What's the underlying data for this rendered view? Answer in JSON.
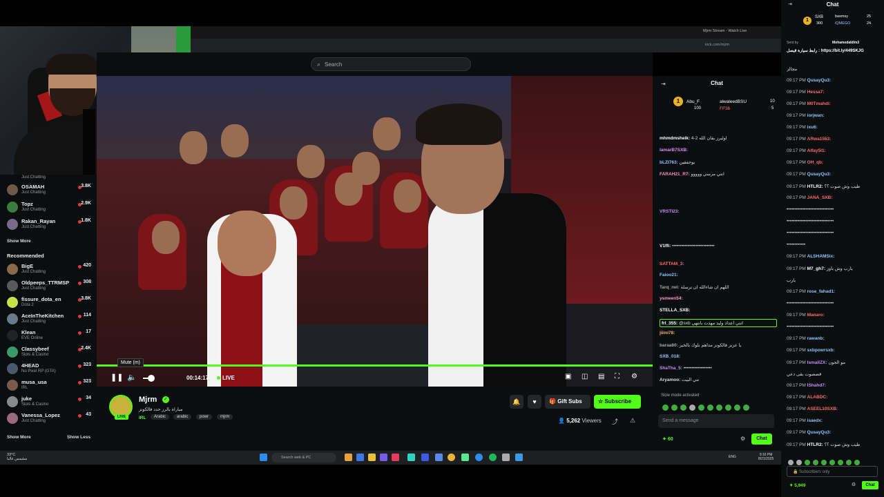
{
  "browser": {
    "tab_title": "Mjrm Stream - Watch Live",
    "url": "kick.com/mjrm"
  },
  "header": {
    "search_placeholder": "Search"
  },
  "sidebar": {
    "following_top": [
      {
        "name": "",
        "category": "Just Chatting",
        "viewers": ""
      },
      {
        "name": "OSAMAH",
        "category": "Just Chatting",
        "viewers": "3.8K"
      },
      {
        "name": "Topz",
        "category": "Just Chatting",
        "viewers": "2.9K"
      },
      {
        "name": "Rakan_Rayan",
        "category": "Just Chatting",
        "viewers": "1.8K"
      }
    ],
    "show_more_1": "Show More",
    "recommended_title": "Recommended",
    "recommended": [
      {
        "name": "BigE",
        "category": "Just Chatting",
        "viewers": "420"
      },
      {
        "name": "Oldpeeps_TTRMSP",
        "category": "Just Chatting",
        "viewers": "308"
      },
      {
        "name": "fissure_dota_en",
        "category": "Dota 2",
        "viewers": "3.8K"
      },
      {
        "name": "AceInTheKitchen",
        "category": "Just Chatting",
        "viewers": "114"
      },
      {
        "name": "Klean",
        "category": "EVE Online",
        "viewers": "17"
      },
      {
        "name": "Classybeef",
        "category": "Slots & Casino",
        "viewers": "2.4K"
      },
      {
        "name": "4HEAD",
        "category": "No Pixel RP (GTA)",
        "viewers": "323"
      },
      {
        "name": "musa_usa",
        "category": "IRL",
        "viewers": "323"
      },
      {
        "name": "juke",
        "category": "Slots & Casino",
        "viewers": "34"
      },
      {
        "name": "Vanessa_Lopez",
        "category": "Just Chatting",
        "viewers": "43"
      }
    ],
    "show_more_2": "Show More",
    "show_less": "Show Less"
  },
  "player": {
    "tooltip": "Mute (m)",
    "time": "00:14:17",
    "live_label": "LIVE",
    "progress": 1.0
  },
  "channel": {
    "name": "Mjrm",
    "title": "مباراة بالرز حدد فالكونز",
    "category": "IRL",
    "tags": [
      "Arabic",
      "arabic",
      "powr",
      "mjrm"
    ],
    "live_badge": "LIVE",
    "gift_label": "Gift Subs",
    "subscribe_label": "Subscribe",
    "viewers_count": "5,262",
    "viewers_label": "Viewers"
  },
  "inner_chat": {
    "title": "Chat",
    "leaders": {
      "first": "Abu_F",
      "first_pts": "100",
      "second": "alwaleedBSU",
      "second_pts": "10",
      "third": "FF36",
      "third_pts": "5"
    },
    "messages": [
      {
        "user": "mhmdmsheik:",
        "text": "اوليرز بقان الله 2-4",
        "color": "#ffffff"
      },
      {
        "user": "lamarB7SXB:",
        "text": "",
        "color": "#e08bff"
      },
      {
        "user": "bLZI763:",
        "text": "يوحفقين",
        "color": "#8bc7ff"
      },
      {
        "user": "FARAH21_R7:",
        "text": "انتي مرسي  ووووو",
        "color": "#ff8bc7"
      },
      {
        "user": "VRSTI23:",
        "text": "",
        "color": "#c78bff"
      },
      {
        "user": "V1ffi:",
        "text": "•••••••••••••••••••••••••••",
        "color": "#ffffff"
      },
      {
        "user": "SATTAM_3:",
        "text": "",
        "color": "#ff6b6b"
      },
      {
        "user": "Faioo21:",
        "text": "",
        "color": "#8bc7ff"
      },
      {
        "user": "Tarq_rwi:",
        "text": "اللهم ان شاءالله ان ترسلة",
        "color": "#aaaaaa"
      },
      {
        "user": "ysmeen54:",
        "text": "",
        "color": "#ff9bd1"
      },
      {
        "user": "STELLA_SXB:",
        "text": "",
        "color": "#ffffff"
      },
      {
        "user": "frl_355:",
        "text": "@sxb انتي اعداد وليد مهدت بانتهي",
        "color": "#ffffff"
      },
      {
        "user": "jiiini78:",
        "text": "",
        "color": "#ffb36b"
      },
      {
        "user": "baraa80:",
        "text": "يا عزيز فالكونز مداهم بلوك بالخير",
        "color": "#aaaaaa"
      },
      {
        "user": "SXB_018:",
        "text": "",
        "color": "#8bc7ff"
      },
      {
        "user": "ShaTha_5:",
        "text": "••••••••••••••••••",
        "color": "#c78bff"
      },
      {
        "user": "Aryamoo:",
        "text": "نتي البيت",
        "color": "#dddddd"
      }
    ],
    "slow_mode": "Slow mode activated",
    "input_placeholder": "Send a message",
    "points": "60",
    "chat_button": "Chat"
  },
  "outer_chat": {
    "title": "Chat",
    "leaders": {
      "first": "SXB",
      "first_pts": "300",
      "second": "basmsy",
      "second_pts": "25",
      "third": "iQMEGO",
      "third_pts": "24"
    },
    "pinned_user": "Mohamedaldim3",
    "pinned_text": "رابط سيارة قيصل : https://bit.ly/449SKJG",
    "messages": [
      {
        "time": "",
        "user": "",
        "text": "مجالز",
        "color": "#ffffff"
      },
      {
        "time": "09:17 PM",
        "user": "QusayQu3:",
        "text": "",
        "color": "#8bc7ff"
      },
      {
        "time": "09:17 PM",
        "user": "Hessa7:",
        "text": "",
        "color": "#ff6b6b"
      },
      {
        "time": "09:17 PM",
        "user": "M0Tmahdi:",
        "text": "",
        "color": "#ff6b6b"
      },
      {
        "time": "09:17 PM",
        "user": "iorjwan:",
        "text": "",
        "color": "#8bc7ff"
      },
      {
        "time": "09:17 PM",
        "user": "ixu6:",
        "text": "",
        "color": "#8bc7ff"
      },
      {
        "time": "09:17 PM",
        "user": "ARwa1553:",
        "text": "",
        "color": "#ff6b6b"
      },
      {
        "time": "09:17 PM",
        "user": "Alfay5I1:",
        "text": "",
        "color": "#ff6b6b"
      },
      {
        "time": "09:17 PM",
        "user": "OH_qb:",
        "text": "",
        "color": "#ff6b6b"
      },
      {
        "time": "09:17 PM",
        "user": "QusayQu3:",
        "text": "",
        "color": "#8bc7ff"
      },
      {
        "time": "09:17 PM",
        "user": "HTLR2:",
        "text": "طيب وش صوت ؟؟",
        "color": "#ffffff"
      },
      {
        "time": "09:17 PM",
        "user": "JANA_SXB:",
        "text": "",
        "color": "#ff6b6b"
      },
      {
        "time": "",
        "user": "",
        "text": "••••••••••••••••••••••••••••••",
        "color": "#ffffff"
      },
      {
        "time": "",
        "user": "",
        "text": "••••••••••••••••••••••••••••••",
        "color": "#ffffff"
      },
      {
        "time": "",
        "user": "",
        "text": "••••••••••••••••••••••••••••••",
        "color": "#ffffff"
      },
      {
        "time": "",
        "user": "",
        "text": "••••••••••••",
        "color": "#ffffff"
      },
      {
        "time": "09:17 PM",
        "user": "ALSHAMSix:",
        "text": "",
        "color": "#8bc7ff"
      },
      {
        "time": "09:17 PM",
        "user": "M7_gh7:",
        "text": "يارب وش باوز",
        "color": "#ffffff"
      },
      {
        "time": "",
        "user": "",
        "text": "يارب",
        "color": "#ffffff"
      },
      {
        "time": "09:17 PM",
        "user": "rose_fahad1:",
        "text": "",
        "color": "#8bc7ff"
      },
      {
        "time": "",
        "user": "",
        "text": "••••••••••••••••••••••••••••••",
        "color": "#ffffff"
      },
      {
        "time": "09:17 PM",
        "user": "Manaro:",
        "text": "",
        "color": "#ff6b6b"
      },
      {
        "time": "",
        "user": "",
        "text": "••••••••••••••••••••••••••••••",
        "color": "#ffffff"
      },
      {
        "time": "09:17 PM",
        "user": "rawanb:",
        "text": "",
        "color": "#8bc7ff"
      },
      {
        "time": "09:17 PM",
        "user": "sxbpowrsxb:",
        "text": "",
        "color": "#8bc7ff"
      },
      {
        "time": "09:17 PM",
        "user": "IsmailZX:",
        "text": "مو الجون",
        "color": "#c78bff"
      },
      {
        "time": "",
        "user": "",
        "text": "قصصوت بقى دعي",
        "color": "#ffffff"
      },
      {
        "time": "09:17 PM",
        "user": "IShahd7:",
        "text": "",
        "color": "#c78bff"
      },
      {
        "time": "09:17 PM",
        "user": "ALABDC:",
        "text": "",
        "color": "#ff6b6b"
      },
      {
        "time": "09:17 PM",
        "user": "ASEEL10SXB:",
        "text": "",
        "color": "#ff6b6b"
      },
      {
        "time": "09:17 PM",
        "user": "isaedx:",
        "text": "",
        "color": "#8bc7ff"
      },
      {
        "time": "09:17 PM",
        "user": "QusayQu3:",
        "text": "",
        "color": "#8bc7ff"
      },
      {
        "time": "09:17 PM",
        "user": "HTLR2:",
        "text": "طيب وش صوت ؟؟",
        "color": "#ffffff"
      }
    ],
    "input_placeholder": "Subscribers only",
    "points": "5,949",
    "chat_button": "Chat"
  },
  "taskbar": {
    "weather_temp": "33°C",
    "weather_desc": "مشمس غالبا",
    "search_placeholder": "Search web & PC",
    "language": "ENG",
    "time": "9:16 PM",
    "date": "8/21/2025"
  },
  "colors": {
    "accent": "#53fc18",
    "background": "#0b0e0f"
  }
}
